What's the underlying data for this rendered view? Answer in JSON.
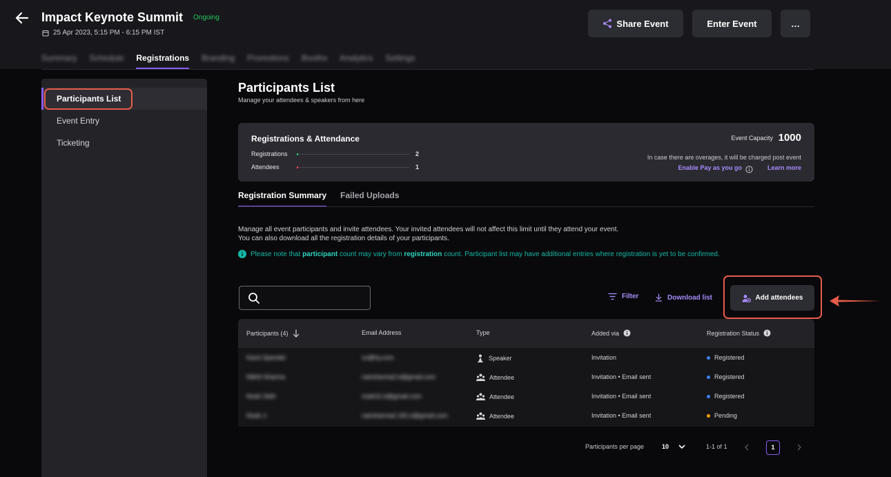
{
  "header": {
    "title": "Impact Keynote Summit",
    "status": "Ongoing",
    "date": "25 Apr 2023, 5:15 PM - 6:15 PM IST",
    "share_label": "Share Event",
    "enter_label": "Enter Event",
    "more_label": "…"
  },
  "tabs": [
    "Summary",
    "Schedule",
    "Registrations",
    "Branding",
    "Promotions",
    "Booths",
    "Analytics",
    "Settings"
  ],
  "sidebar": {
    "items": [
      {
        "label": "Participants List"
      },
      {
        "label": "Event Entry"
      },
      {
        "label": "Ticketing"
      }
    ]
  },
  "main": {
    "title": "Participants List",
    "subtitle": "Manage your attendees & speakers from here"
  },
  "stats": {
    "title": "Registrations & Attendance",
    "registrations_label": "Registrations",
    "registrations_value": "2",
    "attendees_label": "Attendees",
    "attendees_value": "1",
    "capacity_label": "Event Capacity",
    "capacity_value": "1000",
    "overage_note": "In case there are overages, it will be charged post event",
    "pay_link": "Enable Pay as you go",
    "learn_link": "Learn more"
  },
  "sub_tabs": [
    "Registration Summary",
    "Failed Uploads"
  ],
  "description": {
    "line1": "Manage all event participants and invite attendees. Your invited attendees will not affect this limit until they attend your event.",
    "line2": "You can also download all the registration details of your participants.",
    "note_pre": "Please note that ",
    "note_b1": "participant",
    "note_mid": " count may vary from ",
    "note_b2": "registration",
    "note_post": " count. Participant list may have additional entries where registration is yet to be confirmed."
  },
  "toolbar": {
    "filter_label": "Filter",
    "download_label": "Download list",
    "add_label": "Add attendees"
  },
  "table": {
    "headers": [
      "Participants (4)",
      "Email Address",
      "Type",
      "Added via",
      "Registration Status"
    ],
    "rows": [
      {
        "name": "Karol Spender",
        "email": "xx@hy.com",
        "type": "Speaker",
        "added_via": "Invitation",
        "status": "Registered"
      },
      {
        "name": "Nikhil Sharma",
        "email": "nairsharma2.k@gmail.com",
        "type": "Attendee",
        "added_via": "Invitation • Email sent",
        "status": "Registered"
      },
      {
        "name": "Noah Seth",
        "email": "noah11.k@gmail.com",
        "type": "Attendee",
        "added_via": "Invitation • Email sent",
        "status": "Registered"
      },
      {
        "name": "Noah J.",
        "email": "nairsharma2.181.k@gmail.com",
        "type": "Attendee",
        "added_via": "Invitation • Email sent",
        "status": "Pending"
      }
    ]
  },
  "pagination": {
    "per_page_label": "Participants per page",
    "per_page_value": "10",
    "range": "1-1 of 1",
    "current_page": "1"
  },
  "colors": {
    "accent": "#8b5cf6",
    "annotation": "#e85d4a",
    "registered": "#3b82f6",
    "pending": "#f59e0b",
    "ongoing": "#22c55e"
  }
}
